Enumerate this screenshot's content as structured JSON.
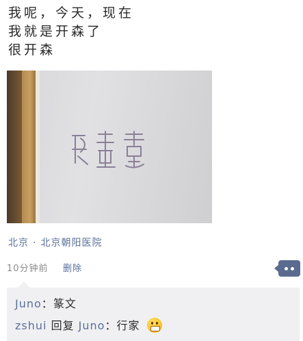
{
  "post": {
    "lines": [
      "我呢，今天，现在",
      "我就是开森了",
      "很开森"
    ]
  },
  "location": {
    "city": "北京",
    "separator": "·",
    "place": "北京朝阳医院"
  },
  "meta": {
    "time": "10分钟前",
    "delete_label": "删除"
  },
  "comments": [
    {
      "user": "Juno",
      "separator": "：",
      "text": "篆文"
    },
    {
      "user": "zshui",
      "reply_word": "回复",
      "reply_to": "Juno",
      "separator": "：",
      "text": "行家",
      "emoji": "grin-emoji"
    }
  ],
  "icons": {
    "comment_button": "comment-bubble-icon"
  },
  "colors": {
    "link": "#5a6f9a",
    "comment_bg": "#f0f0f2",
    "button": "#5b6b8f"
  }
}
